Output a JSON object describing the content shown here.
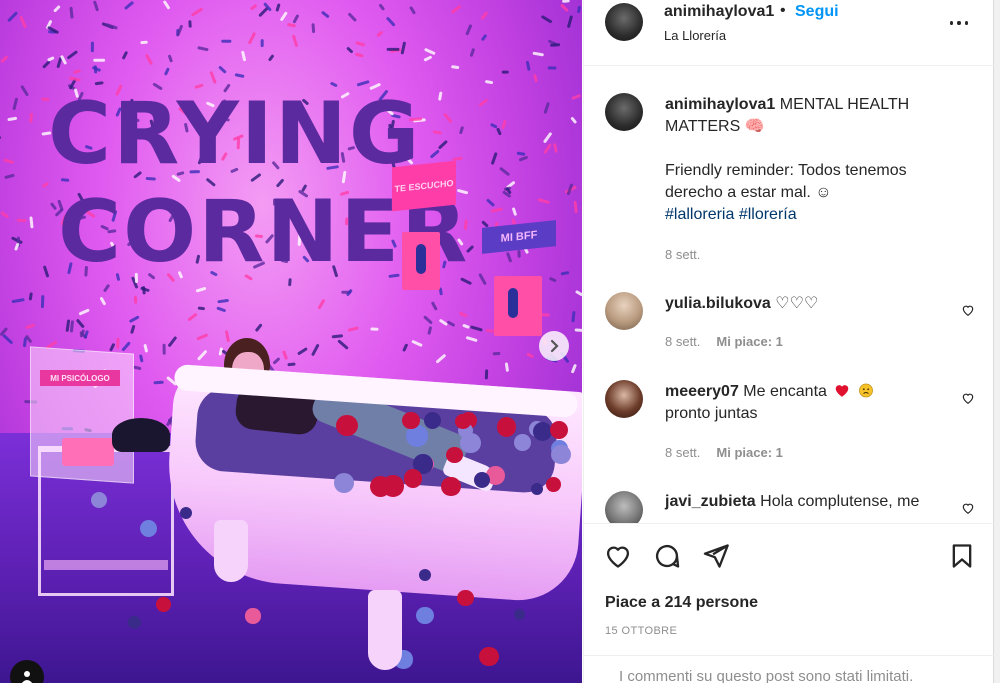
{
  "post": {
    "author": "animihaylova1",
    "dot": "•",
    "follow_label": "Segui",
    "location": "La Llorería",
    "caption_title": "MENTAL HEALTH MATTERS 🧠",
    "caption_body": "Friendly reminder: Todos tenemos derecho a estar mal. ☺",
    "hashtags": "#lalloreria #llorería",
    "caption_time": "8 sett.",
    "likes_text": "Piace a 214 persone",
    "date": "15 OTTOBRE",
    "comments_limited": "I commenti su questo post sono stati limitati."
  },
  "photo": {
    "wall_line1": "CRYING",
    "wall_line2": "CORNER",
    "sign_bff": "MI BFF",
    "sign_pink": "TE ESCUCHO",
    "sign_psico": "MI PSICÓLOGO"
  },
  "comments": [
    {
      "user": "yulia.bilukova",
      "text": "♡♡♡",
      "time": "8 sett.",
      "likes": "Mi piace: 1"
    },
    {
      "user": "meeery07",
      "text": "Me encanta",
      "text2": "pronto juntas",
      "time": "8 sett.",
      "likes": "Mi piace: 1"
    },
    {
      "user": "javi_zubieta",
      "text": "Hola complutense, me"
    }
  ],
  "icons": {
    "more": "more-options-icon",
    "like": "heart-icon",
    "comment": "comment-bubble-icon",
    "share": "paper-plane-icon",
    "save": "bookmark-icon",
    "next": "chevron-right-icon",
    "tag": "user-tag-icon"
  },
  "colors": {
    "link": "#0095f6",
    "hashtag": "#00376b",
    "muted": "#8e8e8e",
    "heart_red": "#ed4956"
  }
}
